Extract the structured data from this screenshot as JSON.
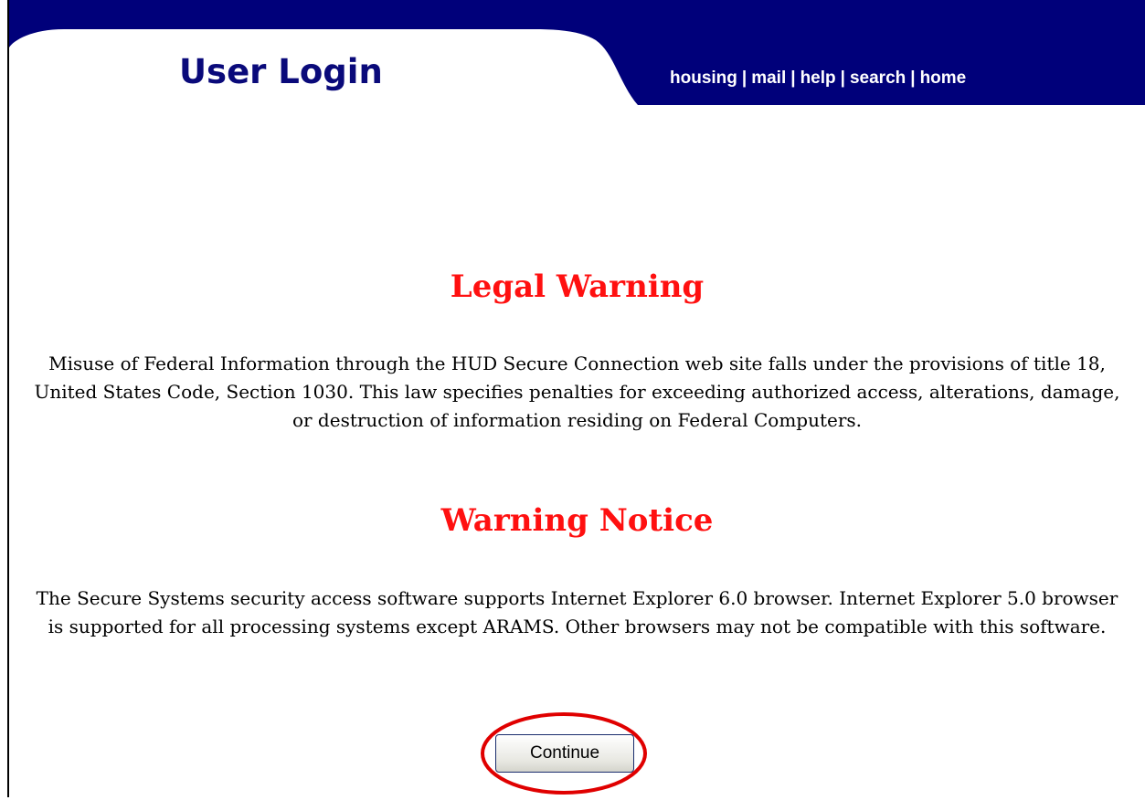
{
  "header": {
    "title": "User Login",
    "nav": {
      "housing": "housing",
      "mail": "mail",
      "help": "help",
      "search": "search",
      "home": "home",
      "separator": "|"
    }
  },
  "legal_warning": {
    "heading": "Legal Warning",
    "text": "Misuse of Federal Information through the HUD Secure Connection web site falls under the provisions of title 18, United States Code, Section 1030. This law specifies penalties for exceeding authorized access, alterations, damage, or destruction of information residing on Federal Computers."
  },
  "warning_notice": {
    "heading": "Warning Notice",
    "text": "The Secure Systems security access software supports Internet Explorer 6.0 browser. Internet Explorer 5.0 browser is supported for all processing systems except ARAMS. Other browsers may not be compatible with this software."
  },
  "continue_button": {
    "label": "Continue"
  },
  "colors": {
    "header_navy": "#00007a",
    "title_blue": "#0a0a7a",
    "heading_red": "#ff1010",
    "highlight_red": "#e00000"
  }
}
